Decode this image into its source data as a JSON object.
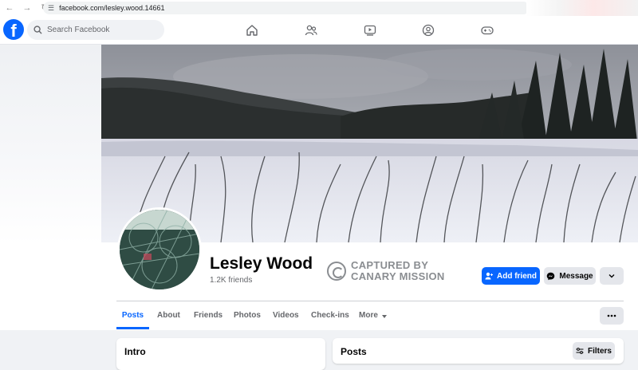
{
  "browser": {
    "url": "facebook.com/lesley.wood.14661",
    "icons": [
      "back-arrow-icon",
      "forward-arrow-icon",
      "reload-icon",
      "site-settings-icon"
    ]
  },
  "header": {
    "logo_letter": "f",
    "search_placeholder": "Search Facebook",
    "nav_icons": [
      "home-icon",
      "friends-icon",
      "watch-icon",
      "groups-icon",
      "gaming-icon"
    ]
  },
  "profile": {
    "name": "Lesley Wood",
    "friends": "1.2K friends"
  },
  "watermark": {
    "line1": "CAPTURED BY",
    "line2": "CANARY MISSION"
  },
  "actions": {
    "add_friend": "Add friend",
    "message": "Message"
  },
  "tabs": [
    {
      "label": "Posts",
      "active": true
    },
    {
      "label": "About"
    },
    {
      "label": "Friends"
    },
    {
      "label": "Photos"
    },
    {
      "label": "Videos"
    },
    {
      "label": "Check-ins"
    },
    {
      "label": "More"
    }
  ],
  "cards": {
    "intro_title": "Intro",
    "posts_title": "Posts",
    "filters_label": "Filters"
  },
  "colors": {
    "brand": "#0866ff",
    "secondary_button": "#e4e6eb",
    "page_background": "#f0f2f5"
  }
}
